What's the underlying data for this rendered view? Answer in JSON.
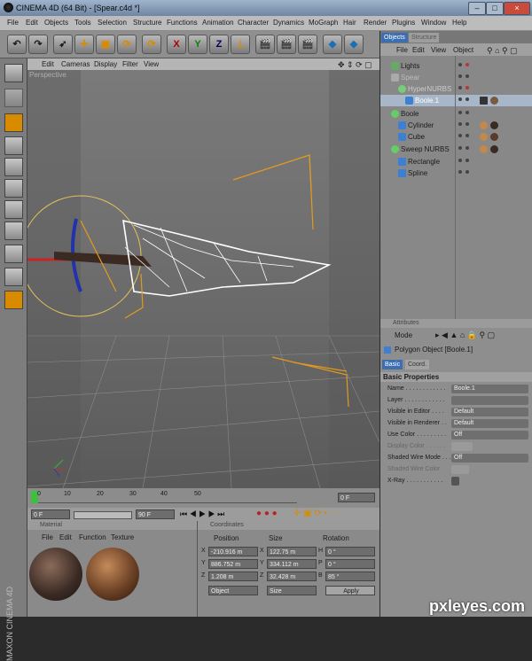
{
  "window": {
    "title": "CINEMA 4D (64 Bit) - [Spear.c4d *]",
    "min": "–",
    "max": "□",
    "close": "×"
  },
  "menubar": [
    "File",
    "Edit",
    "Objects",
    "Tools",
    "Selection",
    "Structure",
    "Functions",
    "Animation",
    "Character",
    "Dynamics",
    "MoGraph",
    "Hair",
    "Render",
    "Plugins",
    "Window",
    "Help"
  ],
  "toolbar": {
    "x": "X",
    "y": "Y",
    "z": "Z"
  },
  "viewport": {
    "menu": [
      "Edit",
      "Cameras",
      "Display",
      "Filter",
      "View"
    ],
    "title": "Perspective"
  },
  "timeline": {
    "ticks": [
      "0",
      "10",
      "20",
      "30",
      "40",
      "50"
    ],
    "frame_field": "0 F",
    "start_field": "0 F",
    "end_field": "90 F"
  },
  "objects_panel": {
    "tabs": [
      "Objects",
      "Structure"
    ],
    "menu": [
      "File",
      "Edit",
      "View",
      "Object"
    ],
    "items": [
      {
        "label": "Lights"
      },
      {
        "label": "Spear"
      },
      {
        "label": "HyperNURBS"
      },
      {
        "label": "Boole.1"
      },
      {
        "label": "Boole"
      },
      {
        "label": "Cylinder"
      },
      {
        "label": "Cube"
      },
      {
        "label": "Sweep NURBS"
      },
      {
        "label": "Rectangle"
      },
      {
        "label": "Spline"
      }
    ]
  },
  "attributes_panel": {
    "header": "Attributes",
    "mode": "Mode",
    "object_title": "Polygon Object [Boole.1]",
    "tabs": [
      "Basic",
      "Coord."
    ],
    "section": "Basic Properties",
    "rows": [
      {
        "label": "Name . . . . . . . . . . . .",
        "value": "Boole.1"
      },
      {
        "label": "Layer . . . . . . . . . . . .",
        "value": ""
      },
      {
        "label": "Visible in Editor . . . .",
        "value": "Default"
      },
      {
        "label": "Visible in Renderer . .",
        "value": "Default"
      },
      {
        "label": "Use Color . . . . . . . . .",
        "value": "Off"
      },
      {
        "label": "Display Color . . . . . .",
        "value": ""
      },
      {
        "label": "Shaded Wire Mode . . .",
        "value": "Off"
      },
      {
        "label": "Shaded Wire Color",
        "value": ""
      },
      {
        "label": "X-Ray . . . . . . . . . . .",
        "value": ""
      }
    ]
  },
  "material_panel": {
    "header": "Material",
    "menu": [
      "File",
      "Edit",
      "Function",
      "Texture"
    ]
  },
  "coord_panel": {
    "header": "Coordinates",
    "cols": [
      "Position",
      "Size",
      "Rotation"
    ],
    "rows": [
      {
        "axis": "X",
        "pos": "-210.916 m",
        "size_axis": "X",
        "size": "122.75 m",
        "rot_axis": "H",
        "rot": "0 °"
      },
      {
        "axis": "Y",
        "pos": "886.752 m",
        "size_axis": "Y",
        "size": "334.112 m",
        "rot_axis": "P",
        "rot": "0 °"
      },
      {
        "axis": "Z",
        "pos": "1.208 m",
        "size_axis": "Z",
        "size": "32.428 m",
        "rot_axis": "B",
        "rot": "85 °"
      }
    ],
    "object_select": "Object",
    "size_select": "Size",
    "apply": "Apply"
  },
  "brand": "MAXON CINEMA 4D",
  "watermark": "pxleyes.com"
}
